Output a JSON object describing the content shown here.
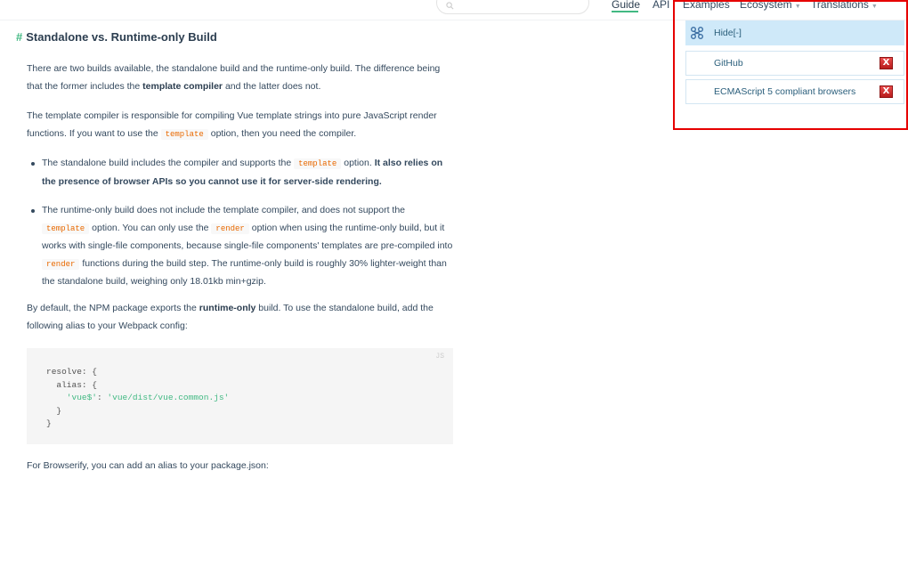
{
  "nav": {
    "search_placeholder": "",
    "links": [
      {
        "label": "Guide",
        "active": true
      },
      {
        "label": "API"
      },
      {
        "label": "Examples"
      },
      {
        "label": "Ecosystem",
        "dropdown": true
      },
      {
        "label": "Translations",
        "dropdown": true
      }
    ],
    "accent_color": "#42b983"
  },
  "article": {
    "heading_hash": "#",
    "heading": "Standalone vs. Runtime-only Build",
    "p1": {
      "a": "There are two builds available, the standalone build and the runtime-only build. The difference being that the former includes the ",
      "b": "template compiler",
      "c": " and the latter does not."
    },
    "p2": {
      "a": "The template compiler is responsible for compiling Vue template strings into pure JavaScript render functions. If you want to use the ",
      "code": "template",
      "c": " option, then you need the compiler."
    },
    "bullet1": {
      "a": "The standalone build includes the compiler and supports the ",
      "code": "template",
      "b": " option. ",
      "strong": "It also relies on the presence of browser APIs so you cannot use it for server-side rendering."
    },
    "bullet2": {
      "a": "The runtime-only build does not include the template compiler, and does not support the ",
      "code1": "template",
      "b": " option. You can only use the ",
      "code2": "render",
      "c": " option when using the runtime-only build, but it works with single-file components, because single-file components' templates are pre-compiled into ",
      "code3": "render",
      "d": " functions during the build step. The runtime-only build is roughly 30% lighter-weight than the standalone build, weighing only 18.01kb min+gzip."
    },
    "p3": {
      "a": "By default, the NPM package exports the ",
      "b": "runtime-only",
      "c": " build. To use the standalone build, add the following alias to your Webpack config:"
    },
    "code": {
      "lang": "JS",
      "l1": "resolve: {",
      "l2": "  alias: {",
      "l3_key": "    'vue$'",
      "l3_sep": ": ",
      "l3_val": "'vue/dist/vue.common.js'",
      "l4": "  }",
      "l5": "}"
    },
    "p4": "For Browserify, you can add an alias to your package.json:"
  },
  "extension_panel": {
    "header_label": "Hide[-]",
    "header_icon": "puzzle-icon",
    "items": [
      {
        "label": "GitHub",
        "close": "X"
      },
      {
        "label": "ECMAScript 5 compliant browsers",
        "close": "X"
      }
    ],
    "highlight_color": "#e60000"
  }
}
